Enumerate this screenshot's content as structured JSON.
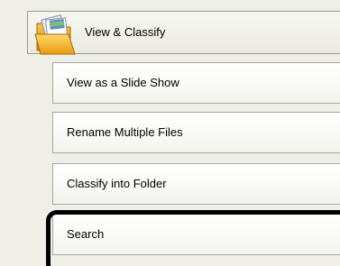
{
  "header": {
    "label": "View & Classify",
    "icon": "folder-icon"
  },
  "menu": {
    "items": [
      {
        "label": "View as a Slide Show"
      },
      {
        "label": "Rename Multiple Files"
      },
      {
        "label": "Classify into Folder"
      },
      {
        "label": "Search"
      }
    ]
  },
  "colors": {
    "panel_background": "#f0efe7",
    "item_border": "#a8a89a",
    "highlight": "#000000"
  }
}
